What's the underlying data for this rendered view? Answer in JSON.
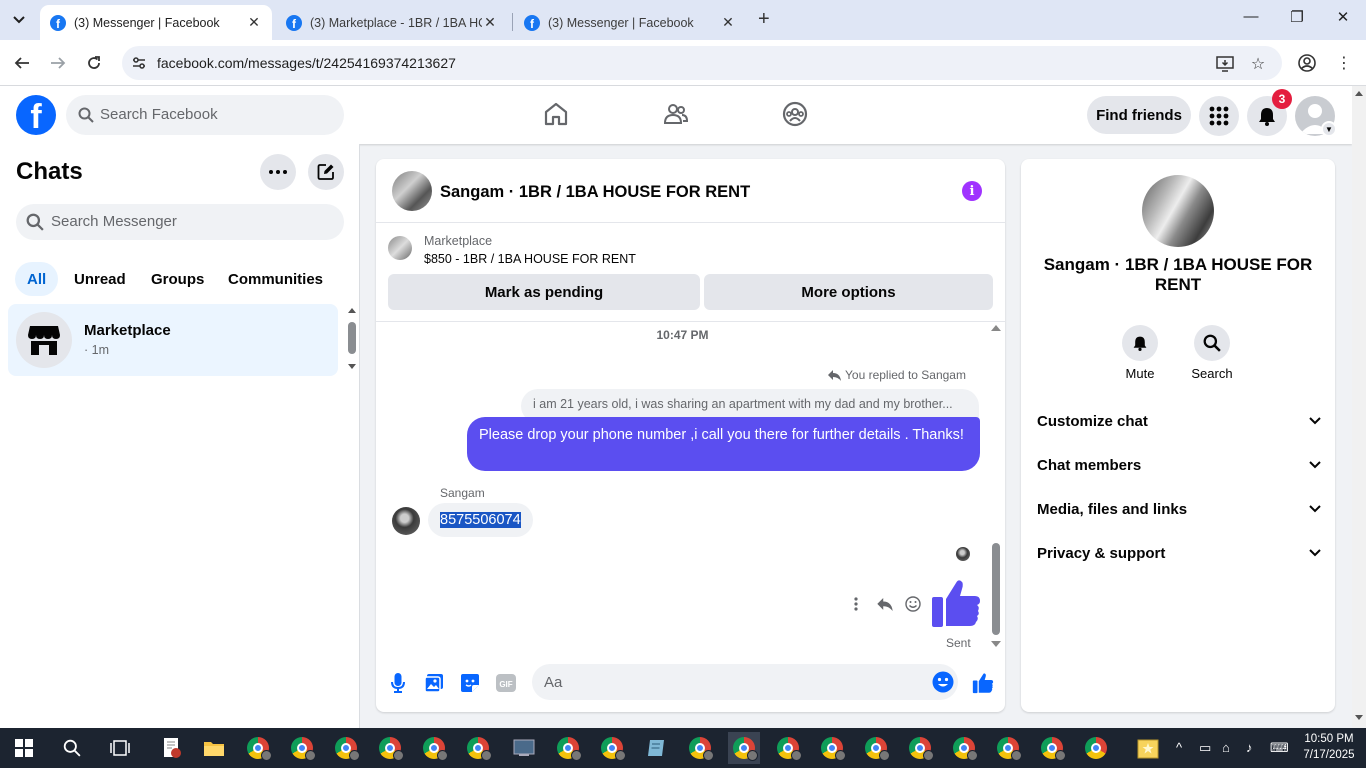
{
  "browser": {
    "tabs": [
      {
        "title": "(3) Messenger | Facebook",
        "active": true
      },
      {
        "title": "(3) Marketplace - 1BR / 1BA HO",
        "active": false
      },
      {
        "title": "(3) Messenger | Facebook",
        "active": false
      }
    ],
    "url": "facebook.com/messages/t/24254169374213627"
  },
  "header": {
    "logo": "f",
    "search_placeholder": "Search Facebook",
    "find_friends": "Find friends",
    "notification_count": "3"
  },
  "chats": {
    "title": "Chats",
    "search_placeholder": "Search Messenger",
    "filters": [
      "All",
      "Unread",
      "Groups",
      "Communities"
    ],
    "active_filter": "All",
    "items": [
      {
        "name": "Marketplace",
        "time": "· 1m"
      }
    ]
  },
  "conversation": {
    "title": "Sangam · 1BR / 1BA HOUSE FOR RENT",
    "marketplace_label": "Marketplace",
    "listing": "$850 - 1BR / 1BA HOUSE FOR RENT",
    "mark_pending": "Mark as pending",
    "more_options": "More options",
    "timestamp": "10:47 PM",
    "replied_to": "You replied to Sangam",
    "quoted_text": "i am 21 years old, i was sharing an apartment with my dad and my brother...",
    "outgoing_text": "Please  drop your phone number ,i call you there for further details . Thanks!",
    "sender_name": "Sangam",
    "incoming_text": "8575506074",
    "sent_status": "Sent",
    "composer_placeholder": "Aa",
    "gif_label": "GIF"
  },
  "info_panel": {
    "name": "Sangam · 1BR / 1BA HOUSE FOR RENT",
    "actions": [
      {
        "label": "Mute",
        "icon": "bell-icon"
      },
      {
        "label": "Search",
        "icon": "search-icon"
      }
    ],
    "sections": [
      "Customize chat",
      "Chat members",
      "Media, files and links",
      "Privacy & support"
    ]
  },
  "taskbar": {
    "time": "10:50 PM",
    "date": "7/17/2025"
  },
  "colors": {
    "brand": "#0866ff",
    "outgoing_bubble": "#5b4ef0",
    "notification_badge": "#e41e3f",
    "info_icon": "#a033ff"
  }
}
